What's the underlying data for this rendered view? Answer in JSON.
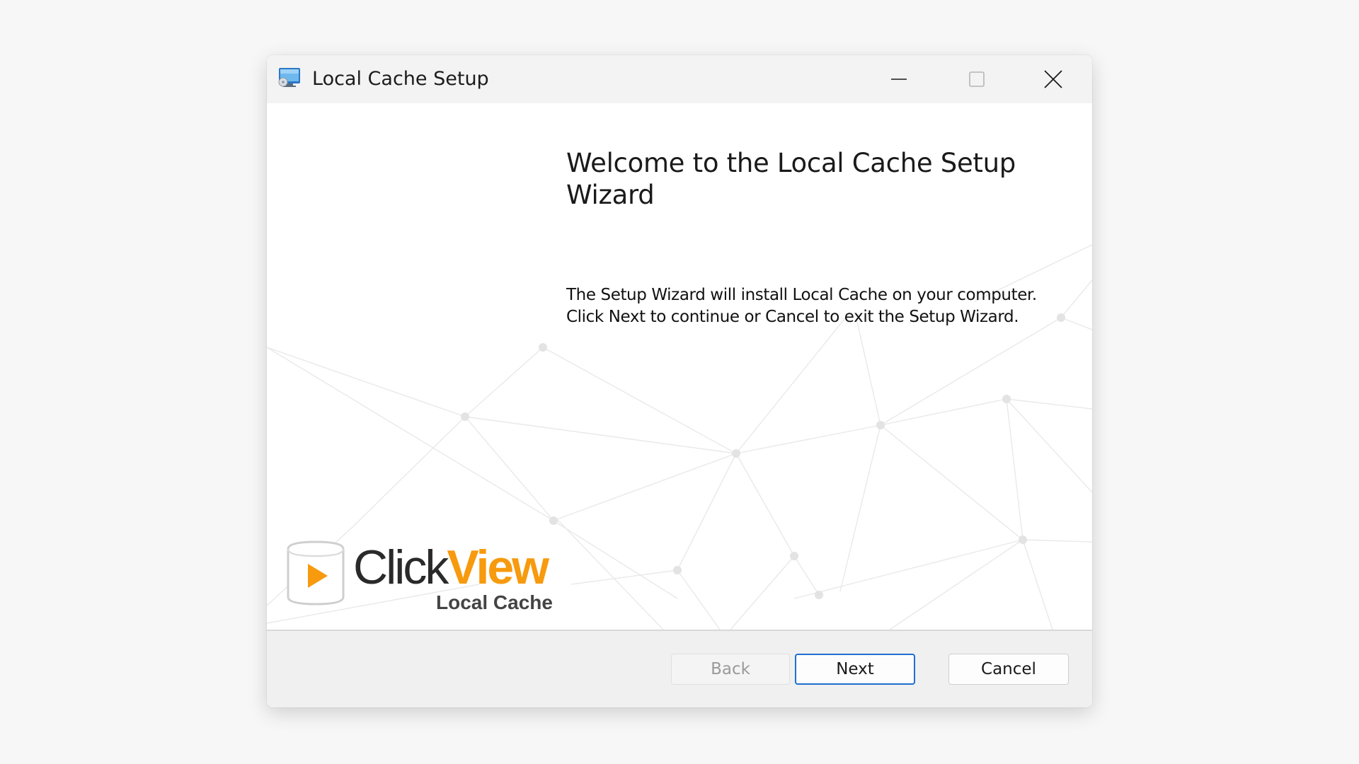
{
  "window": {
    "title": "Local Cache Setup"
  },
  "titlebar_buttons": {
    "minimize_icon": "minimize-icon",
    "maximize_icon": "maximize-icon",
    "close_icon": "close-icon"
  },
  "wizard": {
    "heading_line1": "Welcome to the Local Cache Setup",
    "heading_line2": "Wizard",
    "description_line1": "The Setup Wizard will install Local Cache on your computer.",
    "description_line2": "Click Next to continue or Cancel to exit the Setup Wizard."
  },
  "logo": {
    "word_click": "Click",
    "word_view": "View",
    "subtitle": "Local Cache",
    "brand_color": "#f79a0e"
  },
  "buttons": {
    "back_label": "Back",
    "back_enabled": false,
    "next_label": "Next",
    "cancel_label": "Cancel"
  },
  "colors": {
    "accent": "#1e6fce",
    "background": "#f7f7f7"
  }
}
